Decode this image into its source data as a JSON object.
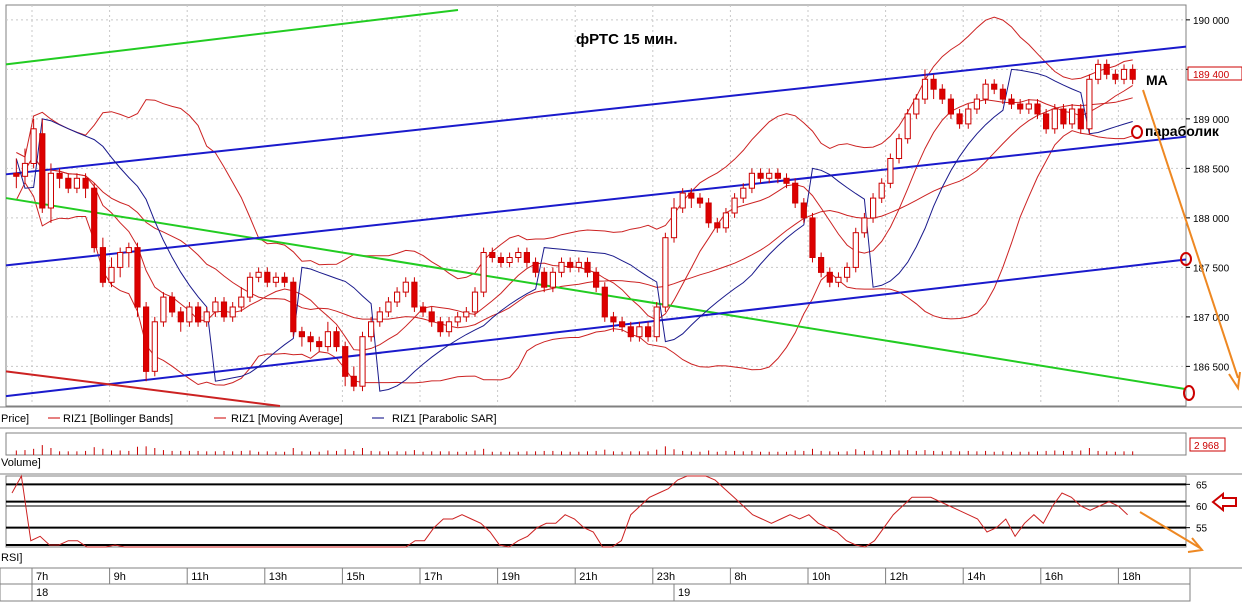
{
  "chart_data": {
    "type": "candlestick",
    "title": "фРТС  15 мин.",
    "instrument": "RIZ1",
    "price_axis": {
      "ylim": [
        186100,
        190150
      ],
      "ticks": [
        186500,
        187000,
        187500,
        188000,
        188500,
        189000,
        189500,
        190000
      ],
      "tick_labels": [
        "186 500",
        "187 000",
        "187 500",
        "188 000",
        "188 500",
        "189 000",
        "189 500",
        "190 000"
      ]
    },
    "current_price_label": "189 400",
    "legend": [
      {
        "label": "Price]",
        "color": "#000000"
      },
      {
        "label": "RIZ1 [Bollinger Bands]",
        "color": "#cc0000"
      },
      {
        "label": "RIZ1 [Moving Average]",
        "color": "#cc0000"
      },
      {
        "label": "RIZ1 [Parabolic SAR]",
        "color": "#000080"
      }
    ],
    "annotations": {
      "ma": "MA",
      "sar": "параболик"
    },
    "volume": {
      "label": "Volume]",
      "current_value_label": "2 968"
    },
    "rsi": {
      "label": "RSI]",
      "ylim": [
        51,
        66
      ],
      "ticks": [
        55,
        60,
        65
      ],
      "tick_labels": [
        "55",
        "60",
        "65"
      ],
      "marked_level": 60,
      "values": [
        63,
        68,
        52,
        53,
        51,
        51,
        52,
        52,
        50,
        50,
        49,
        51,
        50,
        49,
        48,
        48,
        46,
        45,
        45,
        45,
        45,
        46,
        45,
        42,
        41,
        40,
        41,
        42,
        42,
        42,
        44,
        45,
        46,
        45,
        44,
        45,
        46,
        45,
        44,
        44,
        45,
        48,
        50,
        52,
        52,
        55,
        57,
        57,
        58,
        57,
        56,
        54,
        51,
        50,
        52,
        53,
        55,
        56,
        56,
        58,
        57,
        55,
        54,
        50,
        50,
        52,
        58,
        60,
        62,
        63,
        64,
        66,
        67,
        68,
        67,
        66,
        64,
        62,
        60,
        58,
        57,
        56,
        57,
        58,
        57,
        58,
        56,
        55,
        54,
        52,
        51,
        50,
        52,
        55,
        58,
        60,
        62,
        62,
        62,
        61,
        60,
        59,
        58,
        57,
        54,
        55,
        57,
        53,
        56,
        58,
        56,
        60,
        63,
        62,
        60,
        59,
        60,
        61,
        60,
        58
      ]
    },
    "time_axis": {
      "hour_labels": [
        "7h",
        "9h",
        "11h",
        "13h",
        "15h",
        "17h",
        "19h",
        "21h",
        "23h",
        "8h",
        "10h",
        "12h",
        "14h",
        "16h",
        "18h"
      ],
      "day_labels": [
        "18",
        "19"
      ]
    },
    "candles": [
      [
        188450,
        188420,
        188600,
        188300
      ],
      [
        188420,
        188550,
        188700,
        188350
      ],
      [
        188550,
        188900,
        189000,
        188500
      ],
      [
        188850,
        188100,
        189000,
        188050
      ],
      [
        188100,
        188450,
        188550,
        187950
      ],
      [
        188450,
        188400,
        188500,
        188300
      ],
      [
        188400,
        188300,
        188450,
        188250
      ],
      [
        188300,
        188400,
        188450,
        188250
      ],
      [
        188400,
        188300,
        188450,
        188200
      ],
      [
        188300,
        187700,
        188350,
        187650
      ],
      [
        187700,
        187350,
        187800,
        187300
      ],
      [
        187350,
        187500,
        187600,
        187300
      ],
      [
        187500,
        187650,
        187700,
        187400
      ],
      [
        187650,
        187700,
        187750,
        187500
      ],
      [
        187700,
        187100,
        187750,
        187000
      ],
      [
        187100,
        186450,
        187150,
        186350
      ],
      [
        186450,
        186950,
        187000,
        186400
      ],
      [
        186950,
        187200,
        187250,
        186900
      ],
      [
        187200,
        187050,
        187250,
        187000
      ],
      [
        187050,
        186950,
        187100,
        186850
      ],
      [
        186950,
        187100,
        187150,
        186900
      ],
      [
        187100,
        186950,
        187150,
        186900
      ],
      [
        186950,
        187050,
        187100,
        186900
      ],
      [
        187050,
        187150,
        187200,
        187000
      ],
      [
        187150,
        187000,
        187200,
        186950
      ],
      [
        187000,
        187100,
        187150,
        186950
      ],
      [
        187100,
        187200,
        187300,
        187050
      ],
      [
        187200,
        187400,
        187450,
        187150
      ],
      [
        187400,
        187450,
        187500,
        187350
      ],
      [
        187450,
        187350,
        187500,
        187300
      ],
      [
        187350,
        187400,
        187450,
        187300
      ],
      [
        187400,
        187350,
        187450,
        187300
      ],
      [
        187350,
        186850,
        187400,
        186800
      ],
      [
        186850,
        186800,
        186900,
        186700
      ],
      [
        186800,
        186750,
        186850,
        186650
      ],
      [
        186750,
        186700,
        186800,
        186650
      ],
      [
        186700,
        186850,
        186950,
        186650
      ],
      [
        186850,
        186700,
        186900,
        186650
      ],
      [
        186700,
        186400,
        186750,
        186300
      ],
      [
        186400,
        186300,
        186500,
        186250
      ],
      [
        186300,
        186800,
        186850,
        186250
      ],
      [
        186800,
        186950,
        187000,
        186750
      ],
      [
        186950,
        187050,
        187100,
        186900
      ],
      [
        187050,
        187150,
        187200,
        187000
      ],
      [
        187150,
        187250,
        187300,
        187100
      ],
      [
        187250,
        187350,
        187400,
        187200
      ],
      [
        187350,
        187100,
        187400,
        187050
      ],
      [
        187100,
        187050,
        187150,
        187000
      ],
      [
        187050,
        186950,
        187100,
        186900
      ],
      [
        186950,
        186850,
        187000,
        186800
      ],
      [
        186850,
        186950,
        187000,
        186800
      ],
      [
        186950,
        187000,
        187050,
        186900
      ],
      [
        187000,
        187050,
        187100,
        186950
      ],
      [
        187050,
        187250,
        187300,
        187000
      ],
      [
        187250,
        187650,
        187700,
        187200
      ],
      [
        187650,
        187600,
        187700,
        187550
      ],
      [
        187600,
        187550,
        187650,
        187500
      ],
      [
        187550,
        187600,
        187650,
        187500
      ],
      [
        187600,
        187650,
        187700,
        187550
      ],
      [
        187650,
        187550,
        187700,
        187500
      ],
      [
        187550,
        187450,
        187600,
        187400
      ],
      [
        187450,
        187300,
        187500,
        187250
      ],
      [
        187300,
        187450,
        187500,
        187250
      ],
      [
        187450,
        187550,
        187600,
        187400
      ],
      [
        187550,
        187500,
        187600,
        187450
      ],
      [
        187500,
        187550,
        187600,
        187450
      ],
      [
        187550,
        187450,
        187600,
        187400
      ],
      [
        187450,
        187300,
        187500,
        187250
      ],
      [
        187300,
        187000,
        187350,
        186950
      ],
      [
        187000,
        186950,
        187050,
        186850
      ],
      [
        186950,
        186900,
        187000,
        186850
      ],
      [
        186900,
        186800,
        186950,
        186750
      ],
      [
        186800,
        186900,
        186950,
        186750
      ],
      [
        186900,
        186800,
        186950,
        186750
      ],
      [
        186800,
        187100,
        187150,
        186750
      ],
      [
        187100,
        187800,
        187850,
        187050
      ],
      [
        187800,
        188100,
        188200,
        187750
      ],
      [
        188100,
        188250,
        188300,
        188050
      ],
      [
        188250,
        188200,
        188300,
        188100
      ],
      [
        188200,
        188150,
        188250,
        188100
      ],
      [
        188150,
        187950,
        188200,
        187900
      ],
      [
        187950,
        187900,
        188000,
        187850
      ],
      [
        187900,
        188050,
        188100,
        187850
      ],
      [
        188050,
        188200,
        188250,
        188000
      ],
      [
        188200,
        188300,
        188350,
        188150
      ],
      [
        188300,
        188450,
        188500,
        188250
      ],
      [
        188450,
        188400,
        188500,
        188350
      ],
      [
        188400,
        188450,
        188500,
        188350
      ],
      [
        188450,
        188400,
        188500,
        188350
      ],
      [
        188400,
        188350,
        188450,
        188300
      ],
      [
        188350,
        188150,
        188400,
        188100
      ],
      [
        188150,
        188000,
        188200,
        187950
      ],
      [
        188000,
        187600,
        188050,
        187550
      ],
      [
        187600,
        187450,
        187650,
        187400
      ],
      [
        187450,
        187350,
        187500,
        187300
      ],
      [
        187350,
        187400,
        187450,
        187300
      ],
      [
        187400,
        187500,
        187550,
        187350
      ],
      [
        187500,
        187850,
        187900,
        187450
      ],
      [
        187850,
        188000,
        188050,
        187800
      ],
      [
        188000,
        188200,
        188250,
        187950
      ],
      [
        188200,
        188350,
        188400,
        188150
      ],
      [
        188350,
        188600,
        188650,
        188300
      ],
      [
        188600,
        188800,
        188850,
        188550
      ],
      [
        188800,
        189050,
        189100,
        188750
      ],
      [
        189050,
        189200,
        189250,
        189000
      ],
      [
        189200,
        189400,
        189500,
        189150
      ],
      [
        189400,
        189300,
        189450,
        189200
      ],
      [
        189300,
        189200,
        189350,
        189150
      ],
      [
        189200,
        189050,
        189250,
        189000
      ],
      [
        189050,
        188950,
        189100,
        188900
      ],
      [
        188950,
        189100,
        189150,
        188900
      ],
      [
        189100,
        189200,
        189250,
        189050
      ],
      [
        189200,
        189350,
        189400,
        189150
      ],
      [
        189350,
        189300,
        189400,
        189250
      ],
      [
        189300,
        189200,
        189350,
        189150
      ],
      [
        189200,
        189150,
        189250,
        189100
      ],
      [
        189150,
        189100,
        189200,
        189050
      ],
      [
        189100,
        189150,
        189200,
        189050
      ],
      [
        189150,
        189050,
        189200,
        189000
      ],
      [
        189050,
        188900,
        189100,
        188850
      ],
      [
        188900,
        189100,
        189150,
        188850
      ],
      [
        189100,
        188950,
        189150,
        188900
      ],
      [
        188950,
        189100,
        189150,
        188900
      ],
      [
        189100,
        188900,
        189150,
        188850
      ],
      [
        188900,
        189400,
        189450,
        188850
      ],
      [
        189400,
        189550,
        189600,
        189350
      ],
      [
        189550,
        189450,
        189600,
        189400
      ],
      [
        189450,
        189400,
        189500,
        189350
      ],
      [
        189400,
        189500,
        189550,
        189350
      ],
      [
        189500,
        189400,
        189550,
        189350
      ]
    ]
  }
}
